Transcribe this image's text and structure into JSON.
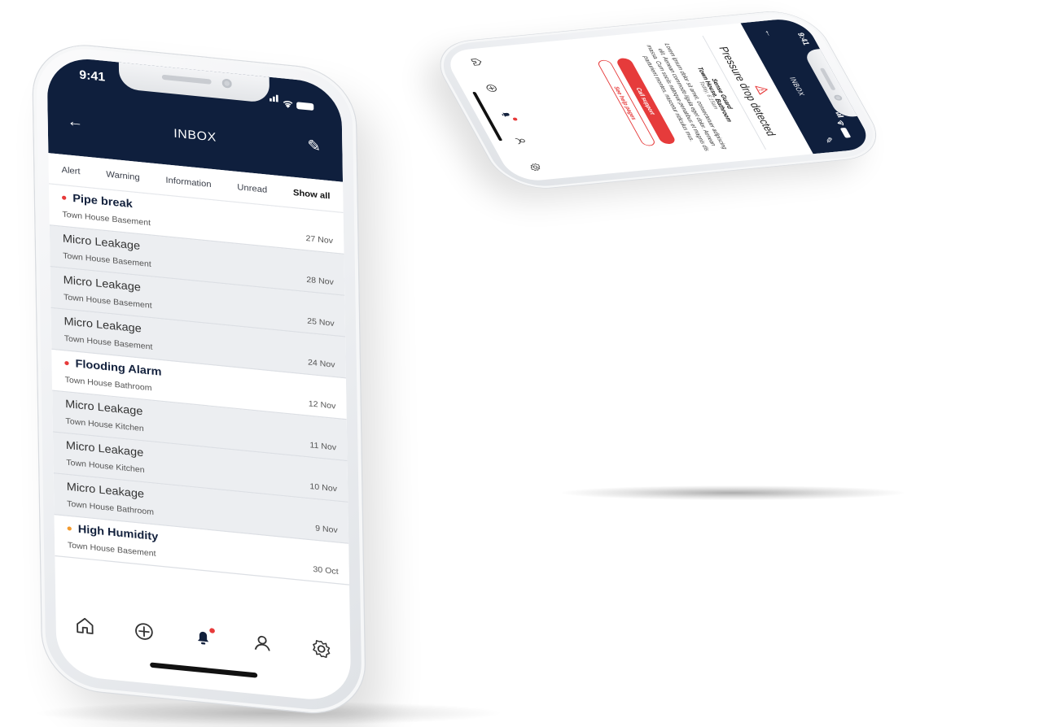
{
  "phone_list": {
    "status_time": "9:41",
    "title": "INBOX",
    "filters": [
      "Alert",
      "Warning",
      "Information",
      "Unread",
      "Show all"
    ],
    "active_filter_index": 4,
    "messages": [
      {
        "title": "Pipe break",
        "location": "Town House Basement",
        "date": "27 Nov",
        "unread": true,
        "dot_color": "#e73a3a"
      },
      {
        "title": "Micro Leakage",
        "location": "Town House Basement",
        "date": "28 Nov",
        "unread": false
      },
      {
        "title": "Micro Leakage",
        "location": "Town House Basement",
        "date": "25 Nov",
        "unread": false
      },
      {
        "title": "Micro Leakage",
        "location": "Town House Basement",
        "date": "24 Nov",
        "unread": false
      },
      {
        "title": "Flooding Alarm",
        "location": "Town House Bathroom",
        "date": "12 Nov",
        "unread": true,
        "dot_color": "#e73a3a"
      },
      {
        "title": "Micro Leakage",
        "location": "Town House Kitchen",
        "date": "11 Nov",
        "unread": false
      },
      {
        "title": "Micro Leakage",
        "location": "Town House Kitchen",
        "date": "10 Nov",
        "unread": false
      },
      {
        "title": "Micro Leakage",
        "location": "Town House Bathroom",
        "date": "9 Nov",
        "unread": false
      },
      {
        "title": "High Humidity",
        "location": "Town House Basement",
        "date": "30 Oct",
        "unread": true,
        "dot_color": "#f29a2e"
      }
    ],
    "bottom_nav": [
      "home-icon",
      "add-icon",
      "bell-icon",
      "profile-icon",
      "settings-icon"
    ]
  },
  "phone_detail": {
    "status_time": "9:41",
    "title": "INBOX",
    "alert_title": "Pressure drop detected",
    "device": "Sense Guard",
    "location": "Town House, Bathroom",
    "time": "Today, 6:15am",
    "body": "Lorem ipsum dolor sit amet, consectetuer adipiscing elit. Aenean commodo ligula eget dolor. Aenean massa. Cum sociis natoque penatibus et magnis dis parturient montes, nascetur ridiculus mus.",
    "primary_button": "Call support",
    "secondary_button": "See help pages",
    "bottom_nav": [
      "home-icon",
      "add-icon",
      "bell-icon",
      "profile-icon",
      "settings-icon"
    ]
  },
  "colors": {
    "header_navy": "#0f1f3d",
    "alert_red": "#e73a3a",
    "humidity_orange": "#f29a2e",
    "read_row_bg": "#eceef1"
  }
}
